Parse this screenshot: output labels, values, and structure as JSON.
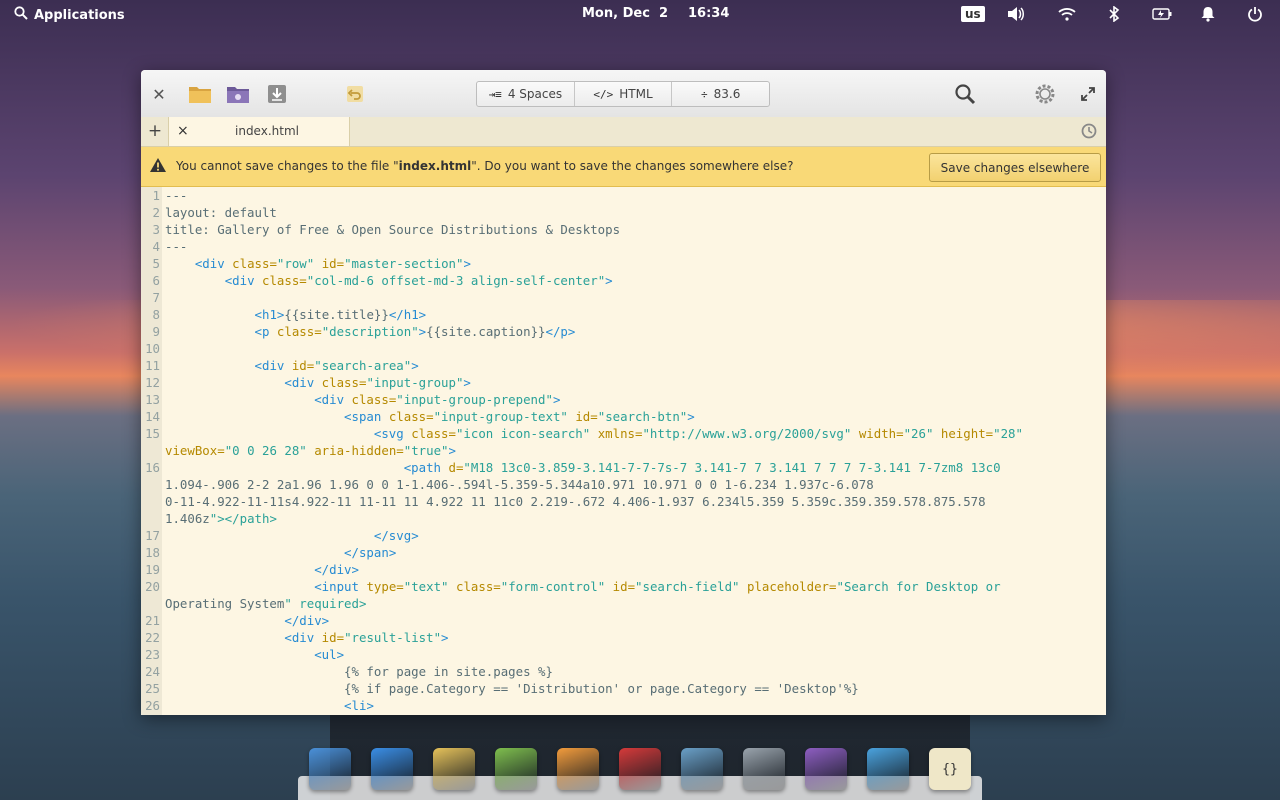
{
  "panel": {
    "apps_label": "Applications",
    "date": "Mon, Dec  2",
    "time": "16:34",
    "keyboard_layout": "us",
    "indicators": [
      "volume-icon",
      "wifi-icon",
      "bluetooth-icon",
      "battery-icon",
      "notifications-icon",
      "power-icon"
    ]
  },
  "window": {
    "headerbar": {
      "indent": "4 Spaces",
      "language": "HTML",
      "zoom": "83.6"
    },
    "tab": {
      "add_label": "+",
      "close_label": "×",
      "title": "index.html"
    },
    "infobar": {
      "message_prefix": "You cannot save changes to the file \"",
      "file": "index.html",
      "message_suffix": "\". Do you want to save the changes somewhere else?",
      "button": "Save changes elsewhere"
    }
  },
  "editor": {
    "lines": [
      {
        "n": "1",
        "t": "---"
      },
      {
        "n": "2",
        "t": "layout: default"
      },
      {
        "n": "3",
        "t": "title: Gallery of Free & Open Source Distributions & Desktops"
      },
      {
        "n": "4",
        "t": "---"
      },
      {
        "n": "5",
        "t": "    <div class=\"row\" id=\"master-section\">"
      },
      {
        "n": "6",
        "t": "        <div class=\"col-md-6 offset-md-3 align-self-center\">"
      },
      {
        "n": "7",
        "t": ""
      },
      {
        "n": "8",
        "t": "            <h1>{{site.title}}</h1>"
      },
      {
        "n": "9",
        "t": "            <p class=\"description\">{{site.caption}}</p>"
      },
      {
        "n": "10",
        "t": ""
      },
      {
        "n": "11",
        "t": "            <div id=\"search-area\">"
      },
      {
        "n": "12",
        "t": "                <div class=\"input-group\">"
      },
      {
        "n": "13",
        "t": "                    <div class=\"input-group-prepend\">"
      },
      {
        "n": "14",
        "t": "                        <span class=\"input-group-text\" id=\"search-btn\">"
      },
      {
        "n": "15",
        "t": "                            <svg class=\"icon icon-search\" xmlns=\"http://www.w3.org/2000/svg\" width=\"26\" height=\"28\""
      },
      {
        "n": "",
        "t": "viewBox=\"0 0 26 28\" aria-hidden=\"true\">"
      },
      {
        "n": "16",
        "t": "                                <path d=\"M18 13c0-3.859-3.141-7-7-7s-7 3.141-7 7 3.141 7 7 7 7-3.141 7-7zm8 13c0"
      },
      {
        "n": "",
        "t": "1.094-.906 2-2 2a1.96 1.96 0 0 1-1.406-.594l-5.359-5.344a10.971 10.971 0 0 1-6.234 1.937c-6.078"
      },
      {
        "n": "",
        "t": "0-11-4.922-11-11s4.922-11 11-11 11 4.922 11 11c0 2.219-.672 4.406-1.937 6.234l5.359 5.359c.359.359.578.875.578"
      },
      {
        "n": "",
        "t": "1.406z\"></path>"
      },
      {
        "n": "17",
        "t": "                            </svg>"
      },
      {
        "n": "18",
        "t": "                        </span>"
      },
      {
        "n": "19",
        "t": "                    </div>"
      },
      {
        "n": "20",
        "t": "                    <input type=\"text\" class=\"form-control\" id=\"search-field\" placeholder=\"Search for Desktop or"
      },
      {
        "n": "",
        "t": "Operating System\" required>"
      },
      {
        "n": "21",
        "t": "                </div>"
      },
      {
        "n": "22",
        "t": "                <div id=\"result-list\">"
      },
      {
        "n": "23",
        "t": "                    <ul>"
      },
      {
        "n": "24",
        "t": "                        {% for page in site.pages %}"
      },
      {
        "n": "25",
        "t": "                        {% if page.Category == 'Distribution' or page.Category == 'Desktop'%}"
      },
      {
        "n": "26",
        "t": "                        <li>"
      }
    ]
  },
  "dock": {
    "items": [
      {
        "name": "multitasking-view-icon",
        "color": "#4a90d9"
      },
      {
        "name": "web-browser-icon",
        "color": "#3a8ee6"
      },
      {
        "name": "mail-icon",
        "color": "#e6c25a"
      },
      {
        "name": "calendar-icon",
        "color": "#7fbf4e"
      },
      {
        "name": "music-icon",
        "color": "#f39c3c"
      },
      {
        "name": "videos-icon",
        "color": "#d63a3a"
      },
      {
        "name": "photos-icon",
        "color": "#6aa0c8"
      },
      {
        "name": "system-settings-icon",
        "color": "#9aa4ad"
      },
      {
        "name": "appcenter-icon",
        "color": "#8e5ec2"
      },
      {
        "name": "installer-icon",
        "color": "#4aa3df"
      },
      {
        "name": "code-editor-icon",
        "color": "#efe7c8"
      }
    ]
  }
}
